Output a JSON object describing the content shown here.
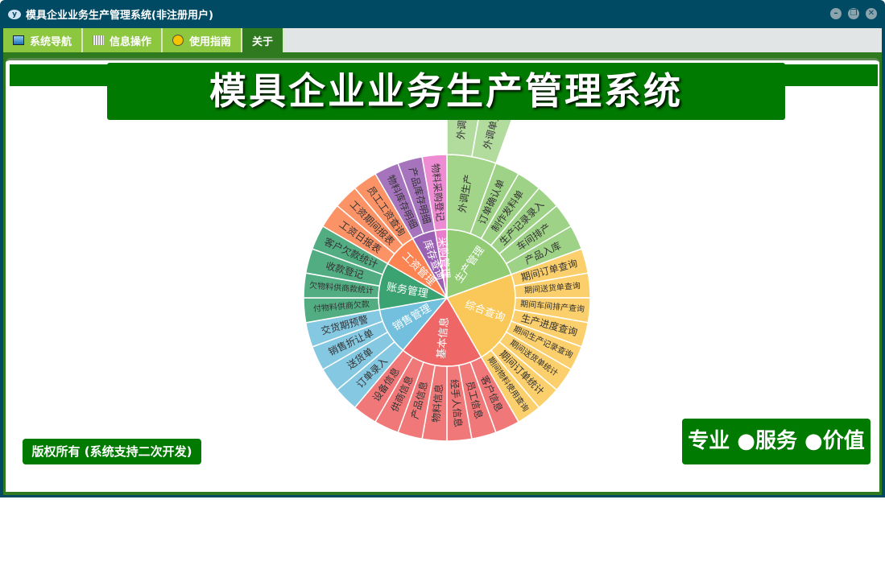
{
  "window": {
    "title": "模具企业业务生产管理系统(非注册用户)",
    "minimize": "–",
    "restore": "❐",
    "close": "✕"
  },
  "menu": [
    {
      "label": "系统导航",
      "icon": "monitor-icon"
    },
    {
      "label": "信息操作",
      "icon": "grid-icon"
    },
    {
      "label": "使用指南",
      "icon": "help-icon"
    },
    {
      "label": "关于",
      "icon": ""
    }
  ],
  "banner": "模具企业业务生产管理系统",
  "footer": {
    "copyright": "版权所有 (系统支持二次开发)",
    "slogan": "专业 ●服务 ●价值"
  },
  "chart_data": {
    "type": "sunburst",
    "nodes": [
      {
        "name": "生产管理",
        "color": "#91cc75",
        "children": [
          {
            "name": "外调生产",
            "children": [
              {
                "name": "外调加工"
              },
              {
                "name": "外调单金额"
              }
            ]
          },
          {
            "name": "订单确认单"
          },
          {
            "name": "制作发料单"
          },
          {
            "name": "生产记录录入"
          },
          {
            "name": "车间排产"
          },
          {
            "name": "产品入库"
          }
        ]
      },
      {
        "name": "综合查询",
        "color": "#fac858",
        "children": [
          {
            "name": "期间订单查询"
          },
          {
            "name": "期间送货单查询"
          },
          {
            "name": "期间车间排产查询"
          },
          {
            "name": "生产进度查询"
          },
          {
            "name": "期间生产记录查询"
          },
          {
            "name": "期间送货单统计"
          },
          {
            "name": "期间订单统计"
          },
          {
            "name": "期间物料使用查询"
          }
        ]
      },
      {
        "name": "基本信息",
        "color": "#ee6666",
        "children": [
          {
            "name": "客户信息"
          },
          {
            "name": "员工信息"
          },
          {
            "name": "经手人信息"
          },
          {
            "name": "物料信息"
          },
          {
            "name": "产品信息"
          },
          {
            "name": "供商信息"
          },
          {
            "name": "设备信息"
          }
        ]
      },
      {
        "name": "销售管理",
        "color": "#73c0de",
        "children": [
          {
            "name": "订单录入"
          },
          {
            "name": "送货单"
          },
          {
            "name": "销售折让单"
          },
          {
            "name": "交货期预警"
          }
        ]
      },
      {
        "name": "账务管理",
        "color": "#3ba272",
        "children": [
          {
            "name": "付物料供商欠款"
          },
          {
            "name": "欠物料供商款统计"
          },
          {
            "name": "收款登记"
          },
          {
            "name": "客户欠款统计"
          }
        ]
      },
      {
        "name": "工资管理",
        "color": "#fc8452",
        "children": [
          {
            "name": "工资日报表"
          },
          {
            "name": "工资期间报表"
          },
          {
            "name": "员工工资查询"
          }
        ]
      },
      {
        "name": "库存查询",
        "color": "#9a60b4",
        "children": [
          {
            "name": "物料库存明细"
          },
          {
            "name": "产品库存明细"
          }
        ]
      },
      {
        "name": "采购管理",
        "color": "#ea7ccc",
        "children": [
          {
            "name": "物料采购登记"
          }
        ]
      }
    ]
  }
}
